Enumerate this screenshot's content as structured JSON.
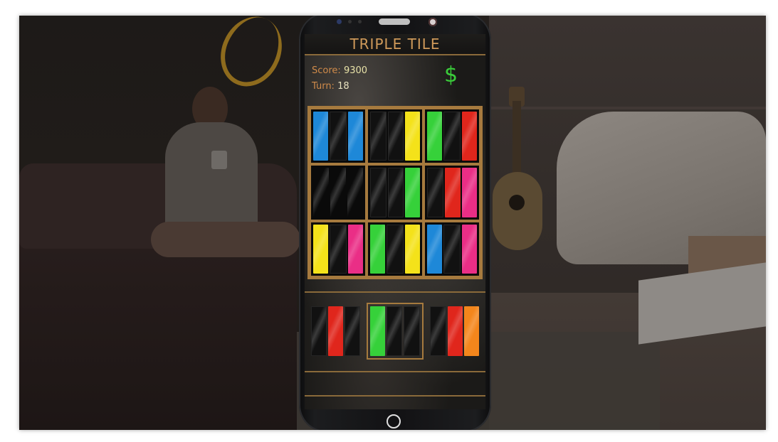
{
  "game": {
    "title": "TRIPLE TILE",
    "score_label": "Score:",
    "score_value": "9300",
    "turn_label": "Turn:",
    "turn_value": "18",
    "currency_symbol": "$"
  },
  "colors": {
    "blue": "#1e88d8",
    "yellow": "#f4e21a",
    "green": "#36d13a",
    "red": "#e0261c",
    "pink": "#ea2e86",
    "orange": "#f3861c",
    "empty": "#111111",
    "gold_border": "#a67a3e"
  },
  "board": [
    [
      "blue",
      "empty",
      "blue"
    ],
    [
      "empty",
      "empty",
      "yellow"
    ],
    [
      "green",
      "empty",
      "red"
    ],
    [
      "blank",
      "blank",
      "blank"
    ],
    [
      "empty",
      "empty",
      "green"
    ],
    [
      "empty",
      "red",
      "pink"
    ],
    [
      "yellow",
      "empty",
      "pink"
    ],
    [
      "green",
      "empty",
      "yellow"
    ],
    [
      "blue",
      "empty",
      "pink"
    ]
  ],
  "tray": [
    {
      "tiles": [
        "empty",
        "red",
        "empty"
      ],
      "selected": false
    },
    {
      "tiles": [
        "green",
        "empty",
        "empty"
      ],
      "selected": true
    },
    {
      "tiles": [
        "empty",
        "red",
        "orange"
      ],
      "selected": false
    }
  ]
}
